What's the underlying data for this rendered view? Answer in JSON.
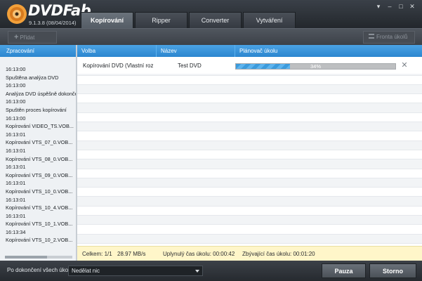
{
  "app": {
    "brand": "DVDFab",
    "version": "9.1.3.8 (08/04/2014)",
    "tabs": [
      "Kopírování",
      "Ripper",
      "Converter",
      "Vytváření"
    ],
    "active_tab": "Kopírování"
  },
  "toolbar": {
    "add_label": "Přidat",
    "queue_label": "Fronta úkolů"
  },
  "left_panel": {
    "header": "Zpracování",
    "log": [
      "16:13:00",
      "Spuštěna analýza DVD",
      "16:13:00",
      "Analýza DVD úspěšně dokonče",
      "16:13:00",
      "Spuštěn proces kopírování",
      "16:13:00",
      "Kopírování VIDEO_TS.VOB...",
      "16:13:01",
      "Kopírování VTS_07_0.VOB...",
      "16:13:01",
      "Kopírování VTS_08_0.VOB...",
      "16:13:01",
      "Kopírování VTS_09_0.VOB...",
      "16:13:01",
      "Kopírování VTS_10_0.VOB...",
      "16:13:01",
      "Kopírování VTS_10_4.VOB...",
      "16:13:01",
      "Kopírování VTS_10_1.VOB...",
      "16:13:34",
      "Kopírování VTS_10_2.VOB..."
    ]
  },
  "grid": {
    "columns": [
      "Volba",
      "Název",
      "Plánovač úkolu"
    ],
    "tasks": [
      {
        "option": "Kopírování DVD (Vlastní roz...",
        "title": "Test DVD",
        "progress_label": "34%",
        "progress_fraction": 0.34
      }
    ]
  },
  "status": {
    "total": "Celkem: 1/1",
    "speed": "28.97 MB/s",
    "elapsed": "Uplynulý čas úkolu: 00:00:42",
    "remaining": "Zbývající čas úkolu: 00:01:20"
  },
  "bottom": {
    "after_label": "Po dokončení všech úkolů:",
    "after_value": "Nedělat nic",
    "pause_label": "Pauza",
    "stop_label": "Storno"
  },
  "colors": {
    "accent": "#2b86cf",
    "status_bg": "#fff6c9",
    "progress": "#3c9bdc"
  }
}
